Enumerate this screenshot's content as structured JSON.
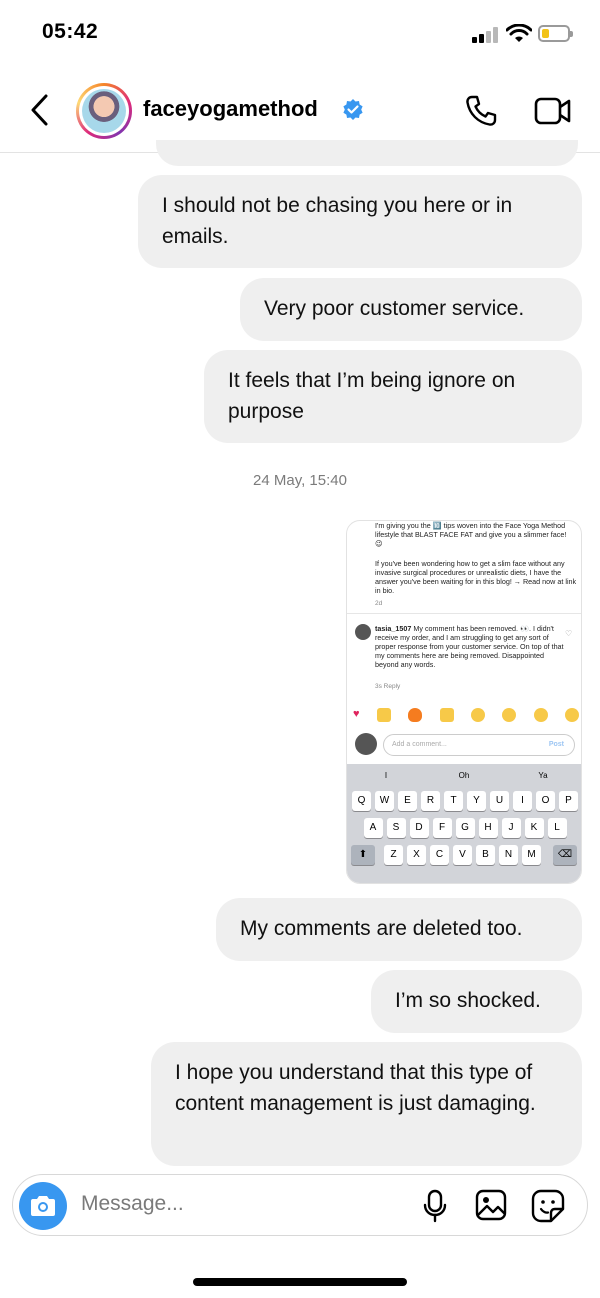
{
  "status_bar": {
    "time": "05:42"
  },
  "header": {
    "username": "faceyogamethod",
    "verified": true
  },
  "messages": [
    {
      "text": "I should not be chasing you here or in emails."
    },
    {
      "text": "Very poor customer service."
    },
    {
      "text": "It feels that I’m being ignore on purpose"
    },
    {
      "text": "My comments are deleted too."
    },
    {
      "text": "I’m so shocked."
    },
    {
      "text": "I hope you understand that this type of content management is just damaging."
    }
  ],
  "timestamp": "24 May, 15:40",
  "screenshot": {
    "caption_line": "I'm giving you the 🔟 tips woven into the Face Yoga Method lifestyle that BLAST FACE FAT and give you a slimmer face! 😉",
    "caption_body": "If you've been wondering how to get a slim face without any invasive surgical procedures or unrealistic diets, I have the answer you've been waiting for in this blog! → Read now at link in bio.",
    "caption_age": "2d",
    "comment_user": "tasia_1507",
    "comment_text": "My comment has been removed. 👀. I didn't receive my order, and I am struggling to get any sort of proper response from your customer service. On top of that my comments here are being removed. Disappointed beyond any words.",
    "comment_meta": "3s   Reply",
    "add_comment_placeholder": "Add a comment...",
    "post_label": "Post",
    "suggestions": [
      "I",
      "Oh",
      "Ya"
    ],
    "keyboard_rows": [
      [
        "Q",
        "W",
        "E",
        "R",
        "T",
        "Y",
        "U",
        "I",
        "O",
        "P"
      ],
      [
        "A",
        "S",
        "D",
        "F",
        "G",
        "H",
        "J",
        "K",
        "L"
      ],
      [
        "Z",
        "X",
        "C",
        "V",
        "B",
        "N",
        "M"
      ]
    ]
  },
  "composer": {
    "placeholder": "Message..."
  },
  "icons": [
    "back-icon",
    "verified-badge-icon",
    "phone-icon",
    "video-icon",
    "camera-icon",
    "microphone-icon",
    "gallery-icon",
    "sticker-icon"
  ],
  "colors": {
    "bubble": "#efefef",
    "accent": "#3897f0",
    "verified": "#3897f0"
  }
}
